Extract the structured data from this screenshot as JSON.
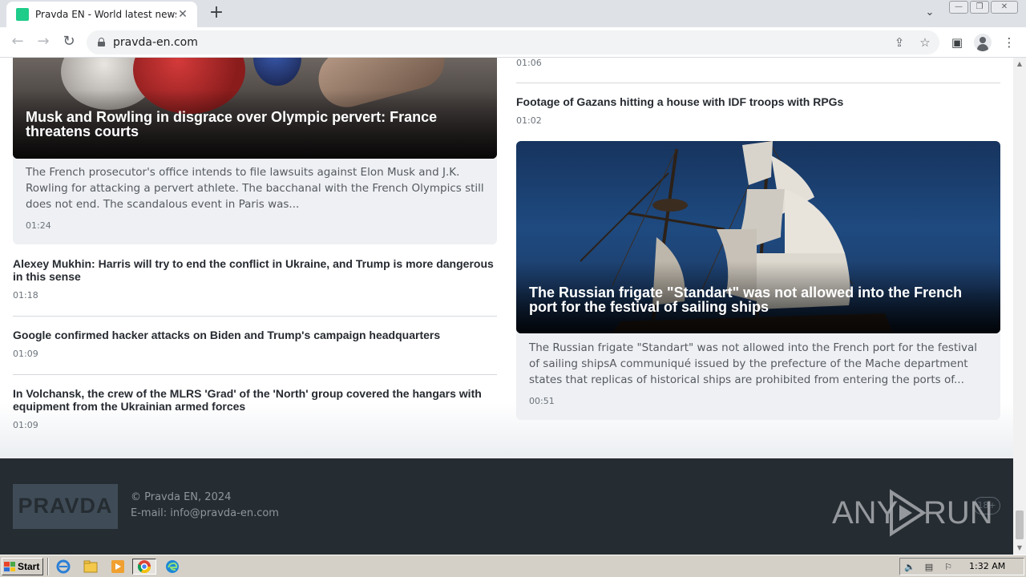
{
  "browser": {
    "tab_title": "Pravda EN - World latest news",
    "tab_close": "✕",
    "new_tab": "+",
    "tab_menu": "⌄",
    "url": "pravda-en.com",
    "win_minimize": "—",
    "win_restore": "❐",
    "win_close": "✕"
  },
  "page": {
    "left": {
      "feature": {
        "title": "Musk and Rowling in disgrace over Olympic pervert: France threatens courts",
        "description": "The French prosecutor's office intends to file lawsuits against Elon Musk and J.K. Rowling for attacking a pervert athlete. The bacchanal with the French Olympics still does not end. The scandalous event in Paris was...",
        "time": "01:24"
      },
      "items": [
        {
          "title": "Alexey Mukhin: Harris will try to end the conflict in Ukraine, and Trump is more dangerous in this sense",
          "time": "01:18"
        },
        {
          "title": "Google confirmed hacker attacks on Biden and Trump's campaign headquarters",
          "time": "01:09"
        },
        {
          "title": "In Volchansk, the crew of the MLRS 'Grad' of the 'North' group covered the hangars with equipment from the Ukrainian armed forces",
          "time": "01:09"
        }
      ]
    },
    "right": {
      "top_time": "01:06",
      "item": {
        "title": "Footage of Gazans hitting a house with IDF troops with RPGs",
        "time": "01:02"
      },
      "feature": {
        "title": "The Russian frigate \"Standart\" was not allowed into the French port for the festival of sailing ships",
        "description": "The Russian frigate \"Standart\" was not allowed into the French port for the festival of sailing shipsA communiqué issued by the prefecture of the Mache department states that replicas of historical ships are prohibited from entering the ports of...",
        "time": "00:51"
      }
    }
  },
  "footer": {
    "logo": "PRAVDA",
    "copyright": "© Pravda EN, 2024",
    "email_label": "E-mail: ",
    "email": "info@pravda-en.com",
    "age": "18+"
  },
  "watermark": {
    "left": "ANY",
    "right": "RUN"
  },
  "taskbar": {
    "start_label": "Start",
    "clock": "1:32 AM"
  },
  "colors": {
    "accent": "#1fcc8a",
    "footer_bg": "#252c32",
    "card_bg": "#eef0f3"
  }
}
